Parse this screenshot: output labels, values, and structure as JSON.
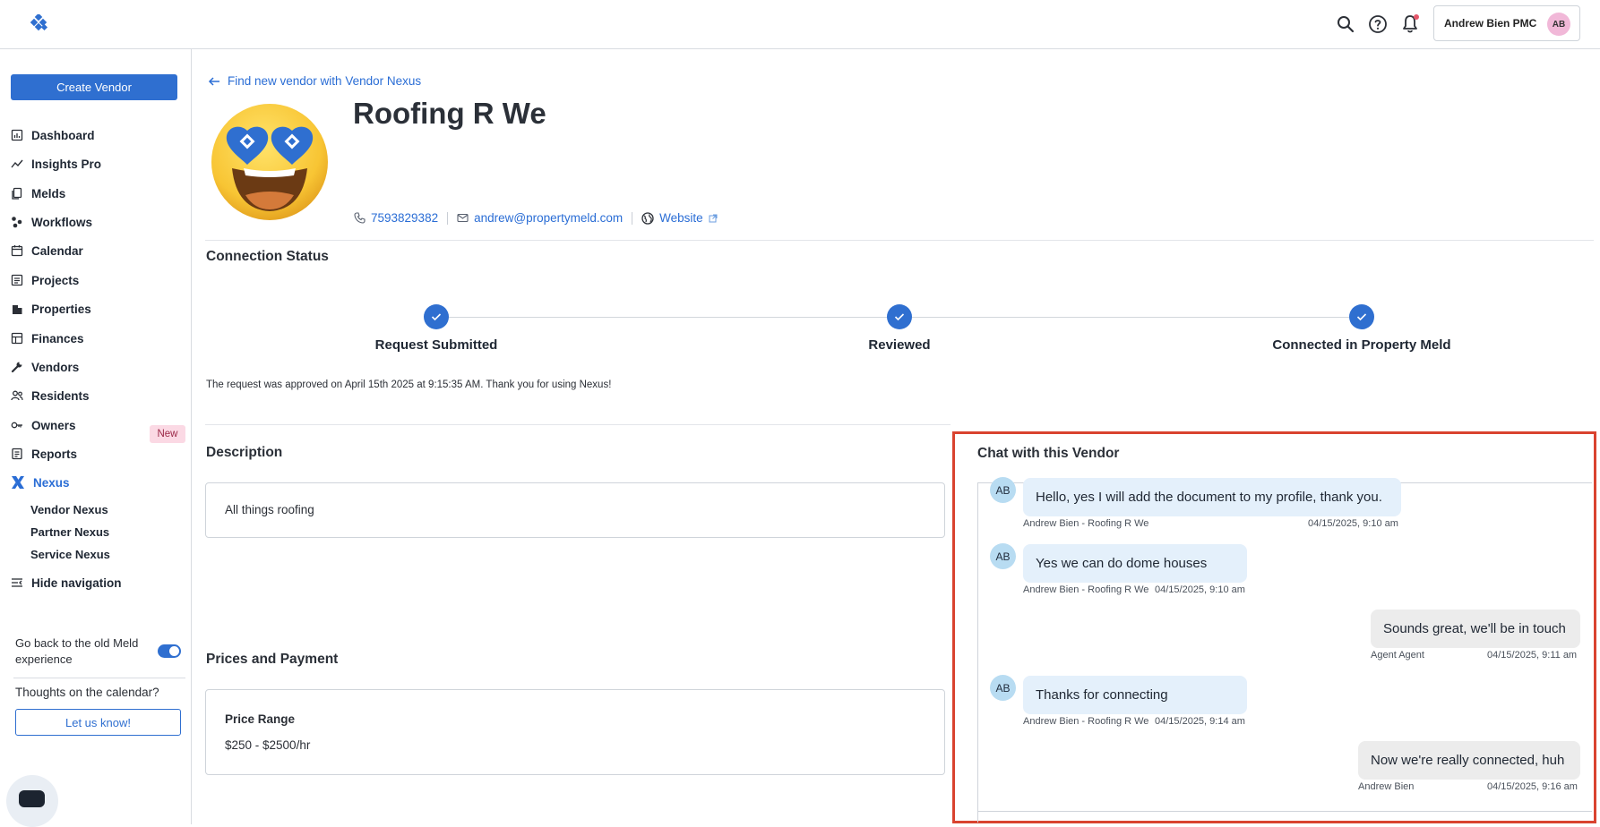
{
  "topbar": {
    "user_name": "Andrew Bien PMC",
    "user_initials": "AB"
  },
  "sidebar": {
    "create_button": "Create Vendor",
    "items": [
      {
        "label": "Dashboard",
        "icon": "dashboard-icon"
      },
      {
        "label": "Insights Pro",
        "icon": "insights-icon"
      },
      {
        "label": "Melds",
        "icon": "melds-icon"
      },
      {
        "label": "Workflows",
        "icon": "workflows-icon"
      },
      {
        "label": "Calendar",
        "icon": "calendar-icon"
      },
      {
        "label": "Projects",
        "icon": "projects-icon"
      },
      {
        "label": "Properties",
        "icon": "properties-icon"
      },
      {
        "label": "Finances",
        "icon": "finances-icon"
      },
      {
        "label": "Vendors",
        "icon": "vendors-icon"
      },
      {
        "label": "Residents",
        "icon": "residents-icon"
      },
      {
        "label": "Owners",
        "icon": "owners-icon"
      },
      {
        "label": "Reports",
        "icon": "reports-icon"
      },
      {
        "label": "Nexus",
        "icon": "nexus-icon",
        "badge": "New"
      }
    ],
    "sub_items": [
      "Vendor Nexus",
      "Partner Nexus",
      "Service Nexus"
    ],
    "hide_nav": "Hide navigation",
    "old_experience_label": "Go back to the old Meld experience",
    "thoughts": "Thoughts on the calendar?",
    "let_us_know": "Let us know!"
  },
  "vendor": {
    "back_link": "Find new vendor with Vendor Nexus",
    "name": "Roofing R We",
    "phone": "7593829382",
    "email": "andrew@propertymeld.com",
    "website": "Website"
  },
  "connection": {
    "title": "Connection Status",
    "steps": [
      "Request Submitted",
      "Reviewed",
      "Connected in Property Meld"
    ],
    "approved_message": "The request was approved on April 15th 2025 at 9:15:35 AM. Thank you for using Nexus!"
  },
  "description": {
    "title": "Description",
    "text": "All things roofing"
  },
  "prices": {
    "title": "Prices and Payment",
    "range_label": "Price Range",
    "range_value": "$250 - $2500/hr"
  },
  "chat": {
    "title": "Chat with this Vendor",
    "messages": [
      {
        "text": "Hello, yes I will add the document to my profile, thank you.",
        "sender": "Andrew Bien - Roofing R We",
        "time": "04/15/2025, 9:10 am",
        "initials": "AB",
        "dir": "in"
      },
      {
        "text": "Yes we can do dome houses",
        "sender": "Andrew Bien - Roofing R We",
        "time": "04/15/2025, 9:10 am",
        "initials": "AB",
        "dir": "in"
      },
      {
        "text": "Sounds great, we'll be in touch",
        "sender": "Agent Agent",
        "time": "04/15/2025, 9:11 am",
        "dir": "out"
      },
      {
        "text": "Thanks for connecting",
        "sender": "Andrew Bien - Roofing R We",
        "time": "04/15/2025, 9:14 am",
        "initials": "AB",
        "dir": "in"
      },
      {
        "text": "Now we're really connected, huh",
        "sender": "Andrew Bien",
        "time": "04/15/2025, 9:16 am",
        "dir": "out"
      }
    ]
  }
}
